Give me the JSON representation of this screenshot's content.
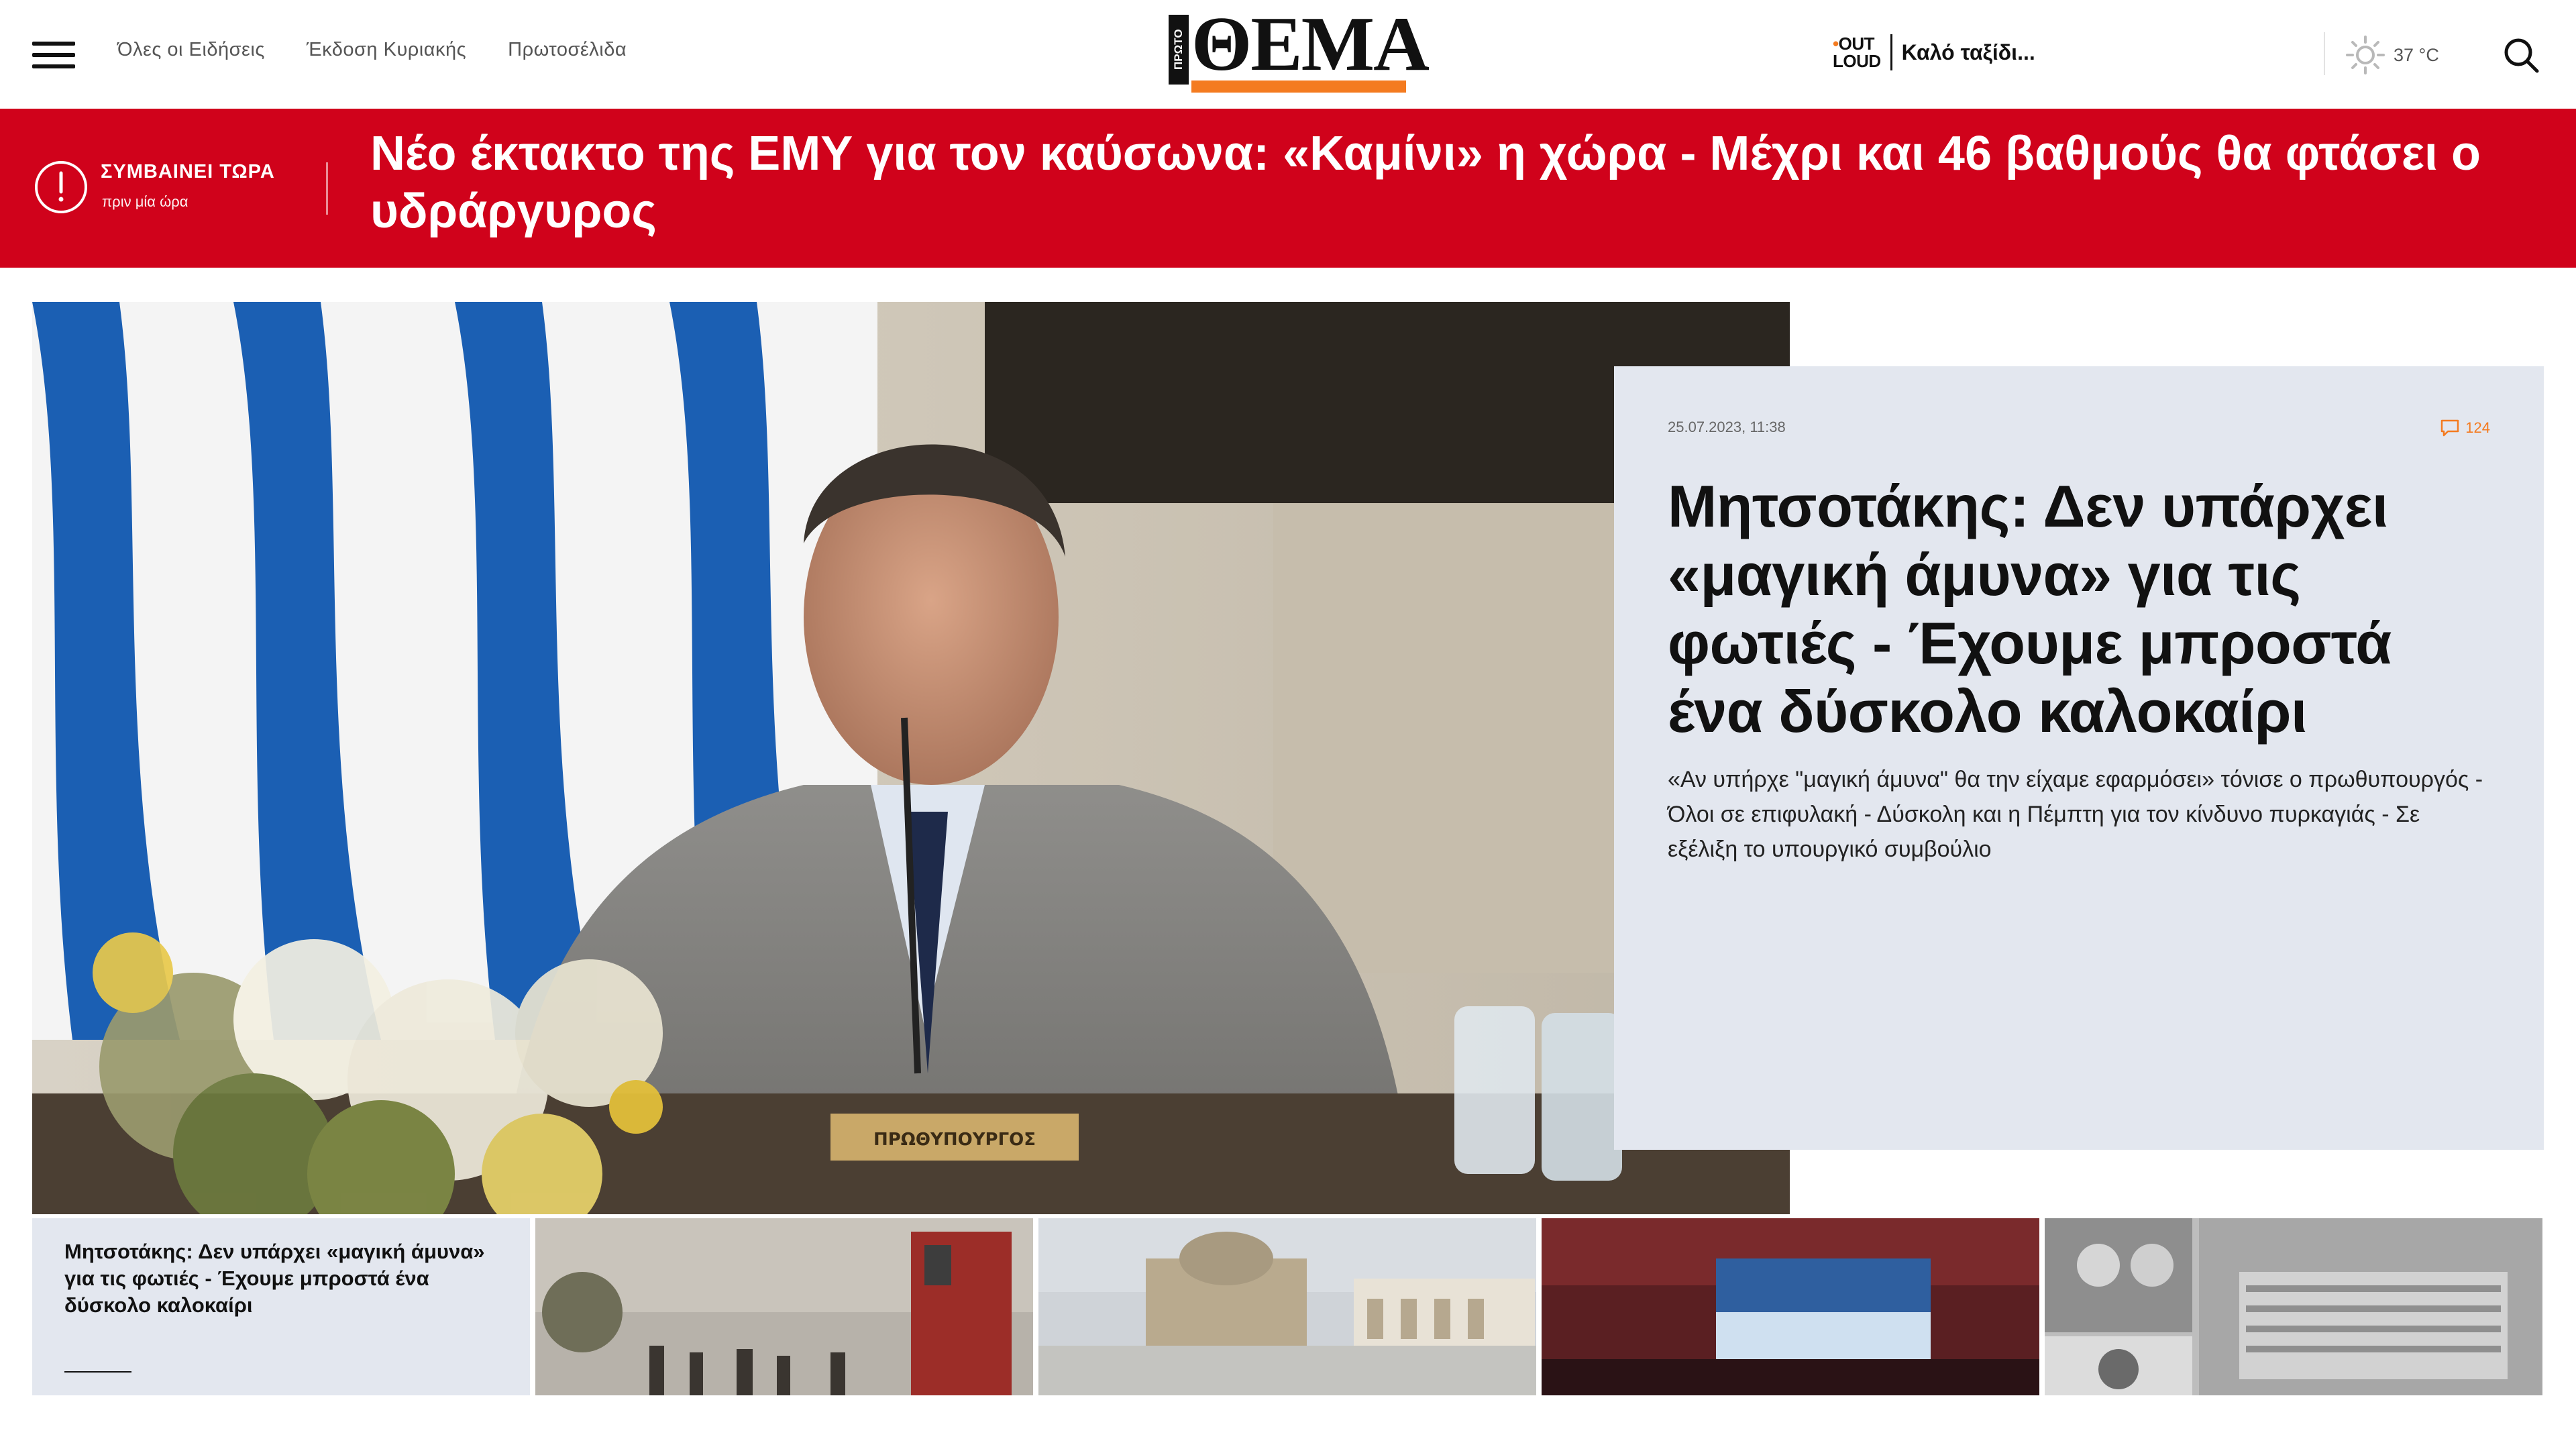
{
  "header": {
    "nav": [
      "Όλες οι Ειδήσεις",
      "Έκδοση Κυριακής",
      "Πρωτοσέλιδα"
    ],
    "logo": {
      "vertical_text": "ΠΡΩΤΟ",
      "name": "ΘΕΜΑ",
      "accent_color": "#f47b20"
    },
    "outloud": {
      "mark_line1": "OUT",
      "mark_line2": "LOUD",
      "tagline": "Καλό ταξίδι..."
    },
    "weather": {
      "temperature": "37 °C",
      "icon": "sun-icon"
    },
    "search_icon": "search-icon"
  },
  "breaking": {
    "label": "ΣΥΜΒΑΙΝΕΙ ΤΩΡΑ",
    "time": "πριν μία ώρα",
    "headline": "Νέο έκτακτο της ΕΜΥ για τον καύσωνα: «Καμίνι» η χώρα - Μέχρι και 46 βαθμούς θα φτάσει ο υδράργυρος",
    "background_color": "#d0021b"
  },
  "main_story": {
    "date": "25.07.2023, 11:38",
    "comments": "124",
    "title": "Μητσοτάκης: Δεν υπάρχει «μαγική άμυνα» για τις φωτιές - Έχουμε μπροστά ένα δύσκολο καλοκαίρι",
    "lead": "«Αν υπήρχε \"μαγική άμυνα\" θα την είχαμε εφαρμόσει» τόνισε ο πρωθυπουργός - Όλοι σε επιφυλακή - Δύσκολη και η Πέμπτη για τον κίνδυνο πυρκαγιάς - Σε εξέλιξη το υπουργικό συμβούλιο",
    "nameplate": "ΠΡΩΘΥΠΟΥΡΓΟΣ"
  },
  "thumbs": {
    "active_title": "Μητσοτάκης: Δεν υπάρχει «μαγική άμυνα» για τις φωτιές - Έχουμε μπροστά ένα δύσκολο καλοκαίρι"
  }
}
